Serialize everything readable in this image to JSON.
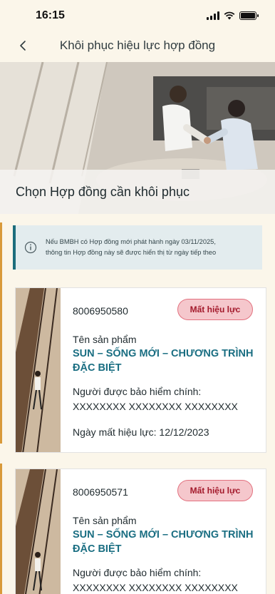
{
  "status_bar": {
    "time": "16:15",
    "battery_level": 1.0
  },
  "header": {
    "title": "Khôi phục hiệu lực hợp đồng"
  },
  "hero": {
    "title": "Chọn Hợp đồng cần khôi phục"
  },
  "notice": {
    "line1": "Nếu BMBH có Hợp đồng mới phát hành ngày 03/11/2025,",
    "line2": "thông tin Hợp đồng này sẽ được hiển thị từ ngày tiếp theo"
  },
  "contracts": [
    {
      "number": "8006950580",
      "status": "Mất hiệu lực",
      "product_label": "Tên sản phẩm",
      "product_name": "SUN – SỐNG MỚI – CHƯƠNG TRÌNH ĐẶC BIỆT",
      "insured_label": "Người được bảo hiểm chính:",
      "insured_value": "XXXXXXXX XXXXXXXX XXXXXXXX",
      "lapse_date": "Ngày mất hiệu lực: 12/12/2023"
    },
    {
      "number": "8006950571",
      "status": "Mất hiệu lực",
      "product_label": "Tên sản phẩm",
      "product_name": "SUN – SỐNG MỚI – CHƯƠNG TRÌNH ĐẶC BIỆT",
      "insured_label": "Người được bảo hiểm chính:",
      "insured_value": "XXXXXXXX XXXXXXXX XXXXXXXX"
    }
  ],
  "colors": {
    "accent": "#1a6e82",
    "badge_bg": "#f5c7cc",
    "badge_text": "#a3192b",
    "page_bg": "#fbf6ea"
  }
}
